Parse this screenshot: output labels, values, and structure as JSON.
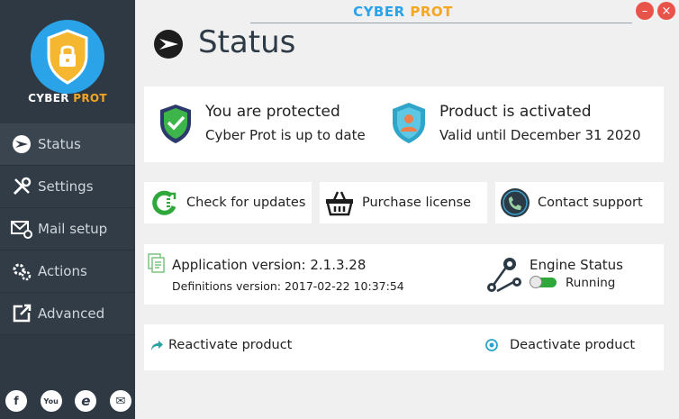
{
  "app": {
    "title_part1": "CYBER ",
    "title_part2": "PROT",
    "logo_part1": "CYBER ",
    "logo_part2": "PROT"
  },
  "window_controls": {
    "minimize": "–",
    "close": "×"
  },
  "sidebar": {
    "items": [
      {
        "label": "Status",
        "icon": "status-icon"
      },
      {
        "label": "Settings",
        "icon": "wrench-screwdriver-icon"
      },
      {
        "label": "Mail setup",
        "icon": "mail-gear-icon"
      },
      {
        "label": "Actions",
        "icon": "gears-icon"
      },
      {
        "label": "Advanced",
        "icon": "external-edit-icon"
      }
    ],
    "socials": [
      {
        "label": "f",
        "icon": "facebook-icon"
      },
      {
        "label": "You",
        "icon": "youtube-icon"
      },
      {
        "label": "e",
        "icon": "internet-explorer-icon"
      },
      {
        "label": "✉",
        "icon": "email-icon"
      }
    ]
  },
  "page": {
    "title": "Status"
  },
  "status": {
    "protection_title": "You are protected",
    "protection_sub": "Cyber Prot is up to date",
    "activation_title": "Product is activated",
    "activation_sub": "Valid until December 31 2020"
  },
  "actions": {
    "check_updates": "Check for updates",
    "purchase_license": "Purchase license",
    "contact_support": "Contact support"
  },
  "info": {
    "app_version": "Application version: 2.1.3.28",
    "definitions_version": "Definitions version: 2017-02-22 10:37:54",
    "engine_title": "Engine Status",
    "engine_state": "Running"
  },
  "product": {
    "reactivate": "Reactivate product",
    "deactivate": "Deactivate product"
  },
  "colors": {
    "sidebar_bg": "#2f3943",
    "accent_blue": "#2aa3e8",
    "accent_orange": "#f5a623",
    "close_red": "#e8534a",
    "ok_green": "#2ea83a"
  }
}
